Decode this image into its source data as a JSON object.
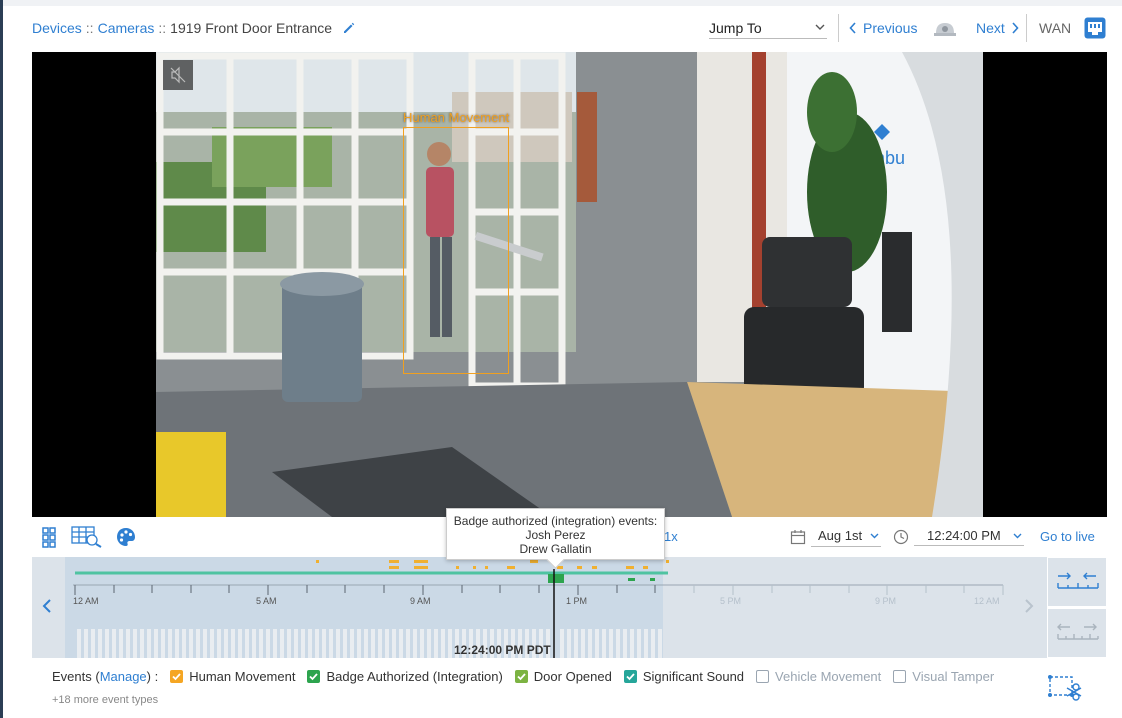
{
  "breadcrumb": {
    "devices": "Devices",
    "cameras": "Cameras",
    "separator": "::",
    "current": "1919 Front Door Entrance"
  },
  "header": {
    "jump_to": "Jump To",
    "previous": "Previous",
    "next": "Next",
    "connection": "WAN"
  },
  "video": {
    "detection_label": "Human Movement",
    "detection_color": "#f0a020"
  },
  "controls": {
    "speed": "1x",
    "date": "Aug 1st",
    "time": "12:24:00 PM",
    "go_live": "Go to live"
  },
  "tooltip": {
    "title": "Badge authorized (integration) events:",
    "names": [
      "Josh Perez",
      "Drew Gallatin"
    ]
  },
  "timeline": {
    "ticks": [
      "12 AM",
      "5 AM",
      "9 AM",
      "1 PM",
      "5 PM",
      "9 PM",
      "12 AM"
    ],
    "cursor_time": "12:24:00 PM PDT"
  },
  "events": {
    "prefix": "Events (",
    "manage": "Manage",
    "suffix": ") :",
    "types": [
      {
        "label": "Human Movement",
        "checked": true,
        "color": "#f5a623"
      },
      {
        "label": "Badge Authorized (Integration)",
        "checked": true,
        "color": "#2da44e"
      },
      {
        "label": "Door Opened",
        "checked": true,
        "color": "#7cb342"
      },
      {
        "label": "Significant Sound",
        "checked": true,
        "color": "#26a69a"
      },
      {
        "label": "Vehicle Movement",
        "checked": false,
        "color": "#9aa5b1"
      },
      {
        "label": "Visual Tamper",
        "checked": false,
        "color": "#9aa5b1"
      }
    ],
    "more": "+18 more event types"
  },
  "colors": {
    "accent": "#2f7fd1",
    "timeline_bg": "#dce3ea",
    "timeline_line": "#4fc3a1"
  }
}
